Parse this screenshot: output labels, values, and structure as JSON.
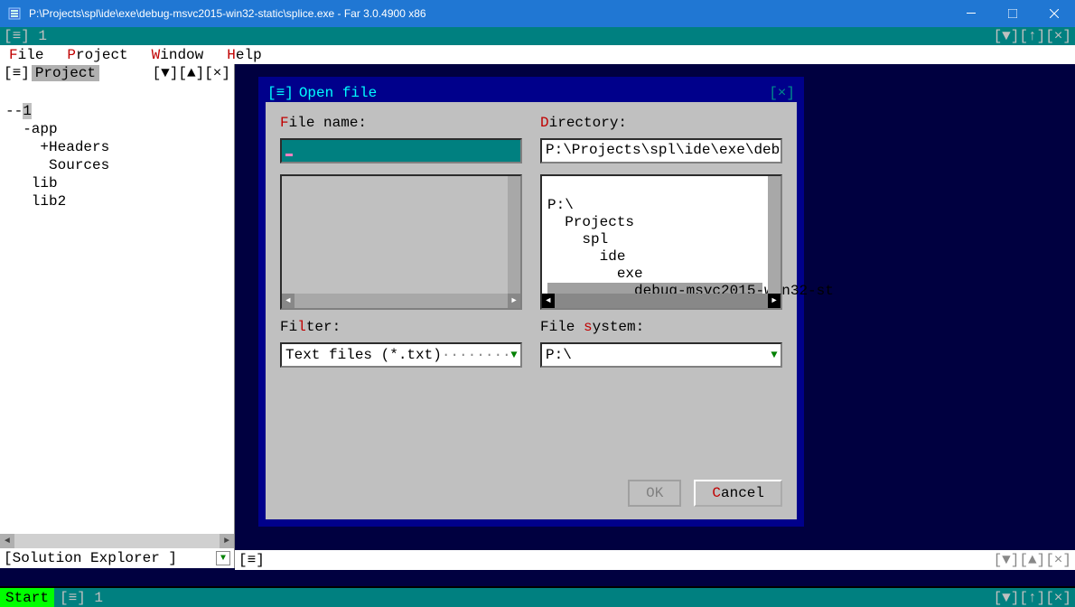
{
  "window": {
    "title": "P:\\Projects\\spl\\ide\\exe\\debug-msvc2015-win32-static\\splice.exe - Far 3.0.4900 x86"
  },
  "topstrip": {
    "left": "[≡] 1",
    "ctrls": "[▼][↑][×]"
  },
  "menubar": {
    "file": "File",
    "project": "Project",
    "window": "Window",
    "help": "Help"
  },
  "sidebar": {
    "header_left": "[≡]",
    "header_label": "Project",
    "header_ctrls": "[▼][▲][×]",
    "footer_label": "[Solution Explorer    ]",
    "tree": {
      "root": "--1",
      "app": "  -app",
      "headers": "    +Headers",
      "sources": "     Sources",
      "lib": "   lib",
      "lib2": "   lib2"
    }
  },
  "dialog": {
    "title_left": "[≡]",
    "title": "Open file",
    "title_right": "[×]",
    "filename_label": "File name:",
    "directory_label": "Directory:",
    "directory_value": "P:\\Projects\\spl\\ide\\exe\\debu",
    "filter_label": "Filter:",
    "filter_value": "Text files (*.txt)",
    "filesystem_label": "File system:",
    "filesystem_value": "P:\\",
    "dirtree": {
      "l0": "P:\\",
      "l1": "  Projects",
      "l2": "    spl",
      "l3": "      ide",
      "l4": "        exe",
      "l5": "          debug-msvc2015-win32-st"
    },
    "ok": "OK",
    "cancel": "Cancel"
  },
  "editorstrip": {
    "left": "[≡]",
    "ctrls": "[▼][▲][×]"
  },
  "status": {
    "start": "Start",
    "seg1": "[≡] 1",
    "ctrls": "[▼][↑][×]"
  }
}
